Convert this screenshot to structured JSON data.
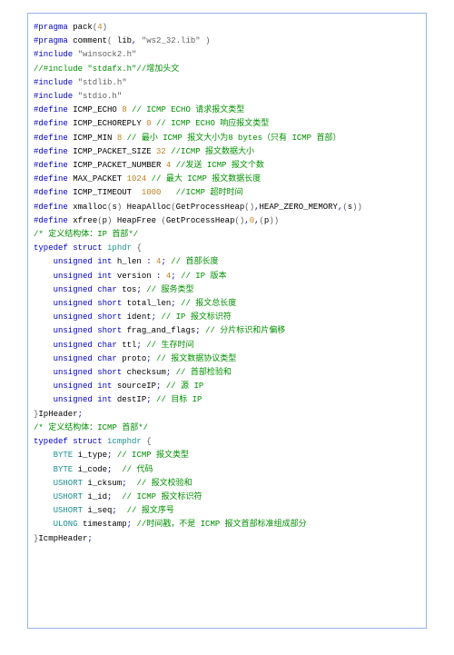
{
  "code_lines": [
    [
      [
        "kw",
        "#pragma"
      ],
      [
        "id",
        " pack"
      ],
      [
        "str",
        "("
      ],
      [
        "num",
        "4"
      ],
      [
        "str",
        ")"
      ]
    ],
    [
      [
        "kw",
        "#pragma"
      ],
      [
        "id",
        " comment"
      ],
      [
        "str",
        "("
      ],
      [
        "id",
        " lib"
      ],
      [
        "kw",
        ","
      ],
      [
        "str",
        " \"ws2_32.lib\" "
      ],
      [
        "str",
        ")"
      ]
    ],
    [
      [
        "kw",
        "#include "
      ],
      [
        "str",
        "\"winsock2.h\""
      ]
    ],
    [
      [
        "cmt",
        "//#include \"stdafx.h\"//增加头文"
      ]
    ],
    [
      [
        "kw",
        "#include "
      ],
      [
        "str",
        "\"stdlib.h\""
      ]
    ],
    [
      [
        "kw",
        "#include "
      ],
      [
        "str",
        "\"stdio.h\""
      ]
    ],
    [
      [
        "id",
        ""
      ]
    ],
    [
      [
        "kw",
        "#define"
      ],
      [
        "id",
        " ICMP_ECHO "
      ],
      [
        "num",
        "8"
      ],
      [
        "id",
        " "
      ],
      [
        "cmt",
        "// ICMP ECHO 请求报文类型"
      ]
    ],
    [
      [
        "kw",
        "#define"
      ],
      [
        "id",
        " ICMP_ECHOREPLY "
      ],
      [
        "num",
        "0"
      ],
      [
        "id",
        " "
      ],
      [
        "cmt",
        "// ICMP ECHO 响应报文类型"
      ]
    ],
    [
      [
        "kw",
        "#define"
      ],
      [
        "id",
        " ICMP_MIN "
      ],
      [
        "num",
        "8"
      ],
      [
        "id",
        " "
      ],
      [
        "cmt",
        "// 最小 ICMP 报文大小为8 bytes（只有 ICMP 首部）"
      ]
    ],
    [
      [
        "id",
        ""
      ]
    ],
    [
      [
        "kw",
        "#define"
      ],
      [
        "id",
        " ICMP_PACKET_SIZE "
      ],
      [
        "num",
        "32"
      ],
      [
        "id",
        " "
      ],
      [
        "cmt",
        "//ICMP 报文数据大小"
      ]
    ],
    [
      [
        "kw",
        "#define"
      ],
      [
        "id",
        " ICMP_PACKET_NUMBER "
      ],
      [
        "num",
        "4"
      ],
      [
        "id",
        " "
      ],
      [
        "cmt",
        "//发送 ICMP 报文个数"
      ]
    ],
    [
      [
        "kw",
        "#define"
      ],
      [
        "id",
        " MAX_PACKET "
      ],
      [
        "num",
        "1024"
      ],
      [
        "id",
        " "
      ],
      [
        "cmt",
        "// 最大 ICMP 报文数据长度"
      ]
    ],
    [
      [
        "kw",
        "#define"
      ],
      [
        "id",
        " ICMP_TIMEOUT  "
      ],
      [
        "num",
        "1000"
      ],
      [
        "id",
        "   "
      ],
      [
        "cmt",
        "//ICMP 超时时间"
      ]
    ],
    [
      [
        "id",
        ""
      ]
    ],
    [
      [
        "kw",
        "#define"
      ],
      [
        "id",
        " xmalloc"
      ],
      [
        "str",
        "("
      ],
      [
        "id",
        "s"
      ],
      [
        "str",
        ")"
      ],
      [
        "id",
        " HeapAlloc"
      ],
      [
        "str",
        "("
      ],
      [
        "id",
        "GetProcessHeap"
      ],
      [
        "str",
        "()"
      ],
      [
        "kw",
        ","
      ],
      [
        "id",
        "HEAP_ZERO_MEMORY"
      ],
      [
        "kw",
        ","
      ],
      [
        "str",
        "("
      ],
      [
        "id",
        "s"
      ],
      [
        "str",
        "))"
      ]
    ],
    [
      [
        "kw",
        "#define"
      ],
      [
        "id",
        " xfree"
      ],
      [
        "str",
        "("
      ],
      [
        "id",
        "p"
      ],
      [
        "str",
        ")"
      ],
      [
        "id",
        " HeapFree "
      ],
      [
        "str",
        "("
      ],
      [
        "id",
        "GetProcessHeap"
      ],
      [
        "str",
        "()"
      ],
      [
        "kw",
        ","
      ],
      [
        "num",
        "0"
      ],
      [
        "kw",
        ","
      ],
      [
        "str",
        "("
      ],
      [
        "id",
        "p"
      ],
      [
        "str",
        "))"
      ]
    ],
    [
      [
        "id",
        ""
      ]
    ],
    [
      [
        "cmt",
        "/* 定义结构体：IP 首部*/"
      ]
    ],
    [
      [
        "kw",
        "typedef struct"
      ],
      [
        "id",
        " "
      ],
      [
        "typ",
        "iphdr"
      ],
      [
        "id",
        " "
      ],
      [
        "str",
        "{"
      ]
    ],
    [
      [
        "id",
        "    "
      ],
      [
        "kw",
        "unsigned int"
      ],
      [
        "id",
        " h_len "
      ],
      [
        "kw",
        ":"
      ],
      [
        "id",
        " "
      ],
      [
        "num",
        "4"
      ],
      [
        "kw",
        ";"
      ],
      [
        "id",
        " "
      ],
      [
        "cmt",
        "// 首部长度"
      ]
    ],
    [
      [
        "id",
        "    "
      ],
      [
        "kw",
        "unsigned int"
      ],
      [
        "id",
        " version "
      ],
      [
        "kw",
        ":"
      ],
      [
        "id",
        " "
      ],
      [
        "num",
        "4"
      ],
      [
        "kw",
        ";"
      ],
      [
        "id",
        " "
      ],
      [
        "cmt",
        "// IP 版本"
      ]
    ],
    [
      [
        "id",
        "    "
      ],
      [
        "kw",
        "unsigned char"
      ],
      [
        "id",
        " tos"
      ],
      [
        "kw",
        ";"
      ],
      [
        "id",
        " "
      ],
      [
        "cmt",
        "// 服务类型"
      ]
    ],
    [
      [
        "id",
        "    "
      ],
      [
        "kw",
        "unsigned short"
      ],
      [
        "id",
        " total_len"
      ],
      [
        "kw",
        ";"
      ],
      [
        "id",
        " "
      ],
      [
        "cmt",
        "// 报文总长度"
      ]
    ],
    [
      [
        "id",
        "    "
      ],
      [
        "kw",
        "unsigned short"
      ],
      [
        "id",
        " ident"
      ],
      [
        "kw",
        ";"
      ],
      [
        "id",
        " "
      ],
      [
        "cmt",
        "// IP 报文标识符"
      ]
    ],
    [
      [
        "id",
        "    "
      ],
      [
        "kw",
        "unsigned short"
      ],
      [
        "id",
        " frag_and_flags"
      ],
      [
        "kw",
        ";"
      ],
      [
        "id",
        " "
      ],
      [
        "cmt",
        "// 分片标识和片偏移"
      ]
    ],
    [
      [
        "id",
        "    "
      ],
      [
        "kw",
        "unsigned char"
      ],
      [
        "id",
        " ttl"
      ],
      [
        "kw",
        ";"
      ],
      [
        "id",
        " "
      ],
      [
        "cmt",
        "// 生存时间"
      ]
    ],
    [
      [
        "id",
        "    "
      ],
      [
        "kw",
        "unsigned char"
      ],
      [
        "id",
        " proto"
      ],
      [
        "kw",
        ";"
      ],
      [
        "id",
        " "
      ],
      [
        "cmt",
        "// 报文数据协议类型"
      ]
    ],
    [
      [
        "id",
        "    "
      ],
      [
        "kw",
        "unsigned short"
      ],
      [
        "id",
        " checksum"
      ],
      [
        "kw",
        ";"
      ],
      [
        "id",
        " "
      ],
      [
        "cmt",
        "// 首部检验和"
      ]
    ],
    [
      [
        "id",
        "    "
      ],
      [
        "kw",
        "unsigned int"
      ],
      [
        "id",
        " sourceIP"
      ],
      [
        "kw",
        ";"
      ],
      [
        "id",
        " "
      ],
      [
        "cmt",
        "// 源 IP"
      ]
    ],
    [
      [
        "id",
        "    "
      ],
      [
        "kw",
        "unsigned int"
      ],
      [
        "id",
        " destIP"
      ],
      [
        "kw",
        ";"
      ],
      [
        "id",
        " "
      ],
      [
        "cmt",
        "// 目标 IP"
      ]
    ],
    [
      [
        "str",
        "}"
      ],
      [
        "id",
        "IpHeader"
      ],
      [
        "kw",
        ";"
      ]
    ],
    [
      [
        "id",
        ""
      ]
    ],
    [
      [
        "cmt",
        "/* 定义结构体：ICMP 首部*/"
      ]
    ],
    [
      [
        "kw",
        "typedef struct"
      ],
      [
        "id",
        " "
      ],
      [
        "typ",
        "icmphdr"
      ],
      [
        "id",
        " "
      ],
      [
        "str",
        "{"
      ]
    ],
    [
      [
        "id",
        "    "
      ],
      [
        "typ",
        "BYTE"
      ],
      [
        "id",
        " i_type"
      ],
      [
        "kw",
        ";"
      ],
      [
        "id",
        " "
      ],
      [
        "cmt",
        "// ICMP 报文类型"
      ]
    ],
    [
      [
        "id",
        "    "
      ],
      [
        "typ",
        "BYTE"
      ],
      [
        "id",
        " i_code"
      ],
      [
        "kw",
        ";"
      ],
      [
        "id",
        "  "
      ],
      [
        "cmt",
        "// 代码"
      ]
    ],
    [
      [
        "id",
        "    "
      ],
      [
        "typ",
        "USHORT"
      ],
      [
        "id",
        " i_cksum"
      ],
      [
        "kw",
        ";"
      ],
      [
        "id",
        "  "
      ],
      [
        "cmt",
        "// 报文校验和"
      ]
    ],
    [
      [
        "id",
        "    "
      ],
      [
        "typ",
        "USHORT"
      ],
      [
        "id",
        " i_id"
      ],
      [
        "kw",
        ";"
      ],
      [
        "id",
        "  "
      ],
      [
        "cmt",
        "// ICMP 报文标识符"
      ]
    ],
    [
      [
        "id",
        "    "
      ],
      [
        "typ",
        "USHORT"
      ],
      [
        "id",
        " i_seq"
      ],
      [
        "kw",
        ";"
      ],
      [
        "id",
        "  "
      ],
      [
        "cmt",
        "// 报文序号"
      ]
    ],
    [
      [
        "id",
        "    "
      ],
      [
        "typ",
        "ULONG"
      ],
      [
        "id",
        " timestamp"
      ],
      [
        "kw",
        ";"
      ],
      [
        "id",
        " "
      ],
      [
        "cmt",
        "//时间戳，不是 ICMP 报文首部标准组成部分"
      ]
    ],
    [
      [
        "str",
        "}"
      ],
      [
        "id",
        "IcmpHeader"
      ],
      [
        "kw",
        ";"
      ]
    ]
  ]
}
